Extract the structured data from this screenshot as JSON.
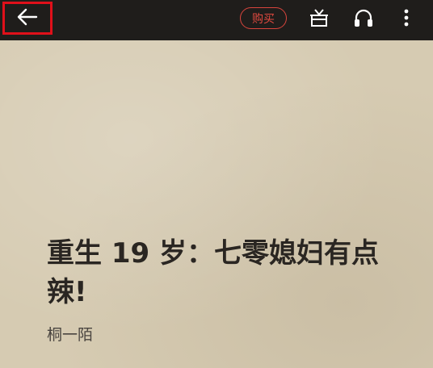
{
  "toolbar": {
    "buy_label": "购买"
  },
  "icons": {
    "back": "arrow-left-icon",
    "gift": "gift-icon",
    "headphone": "headphones-icon",
    "more": "more-vertical-icon"
  },
  "colors": {
    "topbar": "#1f1d1b",
    "accent": "#e0493f",
    "highlight_border": "#e0101a",
    "page": "#d6cbb2"
  },
  "book": {
    "title": "重生 19 岁：七零媳妇有点辣!",
    "author": "桐一陌"
  }
}
